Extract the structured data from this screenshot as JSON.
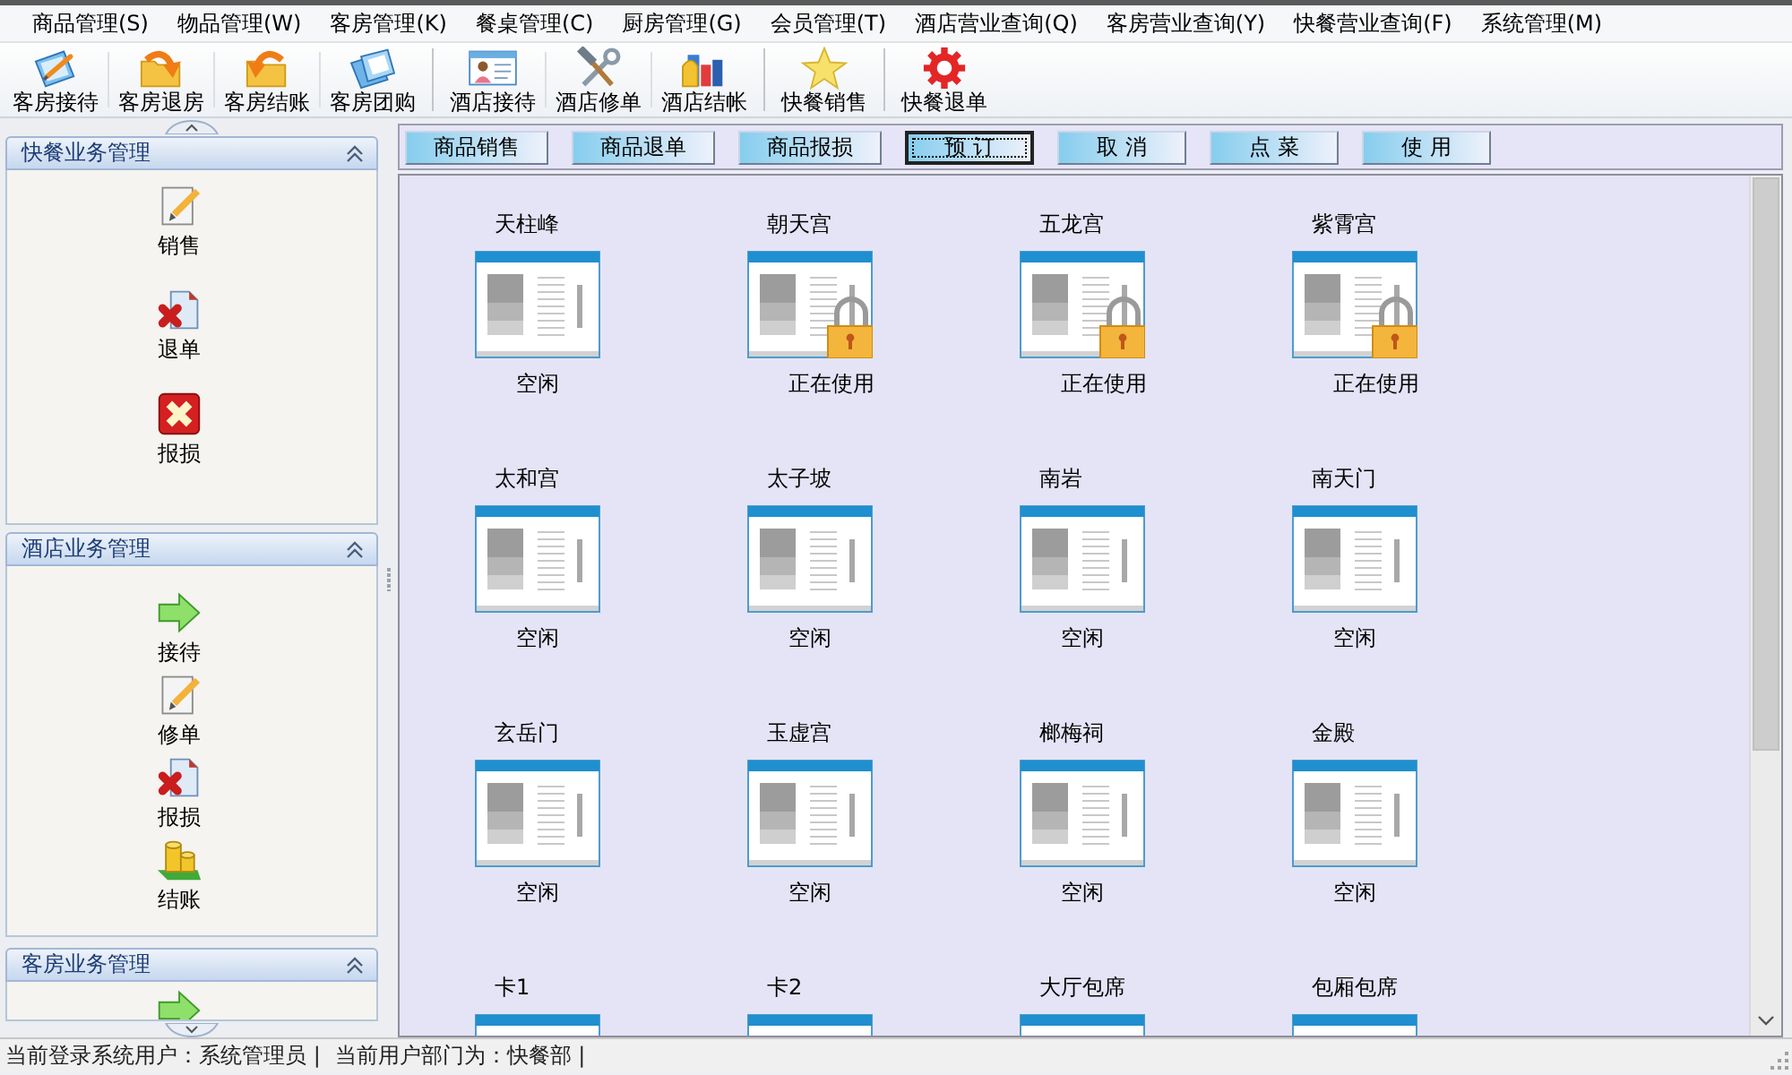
{
  "menu_bar": [
    "商品管理(S)",
    "物品管理(W)",
    "客房管理(K)",
    "餐桌管理(C)",
    "厨房管理(G)",
    "会员管理(T)",
    "酒店营业查询(Q)",
    "客房营业查询(Y)",
    "快餐营业查询(F)",
    "系统管理(M)"
  ],
  "toolbar": [
    {
      "buttons": [
        "客房接待",
        "客房退房",
        "客房结账",
        "客房团购"
      ]
    },
    {
      "buttons": [
        "酒店接待",
        "酒店修单",
        "酒店结帐"
      ]
    },
    {
      "buttons": [
        "快餐销售"
      ]
    },
    {
      "buttons": [
        "快餐退单"
      ]
    }
  ],
  "sidebar": [
    {
      "title": "快餐业务管理",
      "expanded": true,
      "items": [
        {
          "kind": "sale",
          "label": "销售"
        },
        {
          "kind": "void",
          "label": "退单"
        },
        {
          "kind": "damage",
          "label": "报损"
        }
      ]
    },
    {
      "title": "酒店业务管理",
      "expanded": true,
      "items": [
        {
          "kind": "reception",
          "label": "接待"
        },
        {
          "kind": "edit",
          "label": "修单"
        },
        {
          "kind": "void",
          "label": "报损"
        },
        {
          "kind": "checkout",
          "label": "结账"
        }
      ]
    },
    {
      "title": "客房业务管理",
      "expanded": true,
      "items": [
        {
          "kind": "reception"
        }
      ]
    }
  ],
  "actions": [
    {
      "label": "商品销售",
      "focused": false
    },
    {
      "label": "商品退单",
      "focused": false
    },
    {
      "label": "商品报损",
      "focused": false
    },
    {
      "label": "预 订",
      "focused": true
    },
    {
      "label": "取 消",
      "focused": false
    },
    {
      "label": "点 菜",
      "focused": false
    },
    {
      "label": "使 用",
      "focused": false
    }
  ],
  "rooms": [
    {
      "name": "天柱峰",
      "status": "空闲",
      "in_use": false
    },
    {
      "name": "朝天宫",
      "status": "正在使用",
      "in_use": true
    },
    {
      "name": "五龙宫",
      "status": "正在使用",
      "in_use": true
    },
    {
      "name": "紫霄宫",
      "status": "正在使用",
      "in_use": true
    },
    {
      "name": "太和宫",
      "status": "空闲",
      "in_use": false
    },
    {
      "name": "太子坡",
      "status": "空闲",
      "in_use": false
    },
    {
      "name": "南岩",
      "status": "空闲",
      "in_use": false
    },
    {
      "name": "南天门",
      "status": "空闲",
      "in_use": false
    },
    {
      "name": "玄岳门",
      "status": "空闲",
      "in_use": false
    },
    {
      "name": "玉虚宫",
      "status": "空闲",
      "in_use": false
    },
    {
      "name": "榔梅祠",
      "status": "空闲",
      "in_use": false
    },
    {
      "name": "金殿",
      "status": "空闲",
      "in_use": false
    },
    {
      "name": "卡1"
    },
    {
      "name": "卡2"
    },
    {
      "name": "大厅包席"
    },
    {
      "name": "包厢包席"
    }
  ],
  "status_bar": [
    "当前登录系统用户：系统管理员 |",
    "当前用户部门为：快餐部 |"
  ]
}
